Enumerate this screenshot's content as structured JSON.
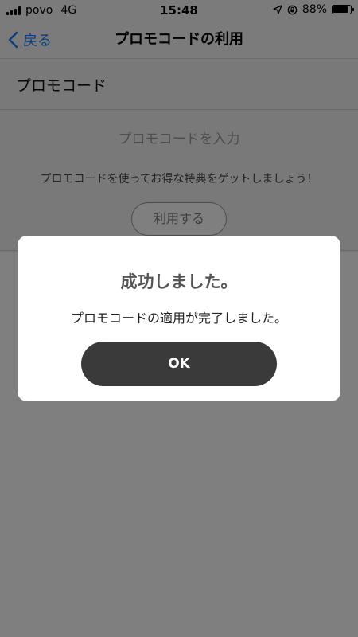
{
  "status_bar": {
    "carrier": "povo",
    "network": "4G",
    "time": "15:48",
    "battery": "88%",
    "battery_level": 0.88
  },
  "nav": {
    "back_label": "戻る",
    "title": "プロモコードの利用"
  },
  "section": {
    "label": "プロモコード"
  },
  "promo": {
    "input_placeholder": "プロモコードを入力",
    "description": "プロモコードを使ってお得な特典をゲットしましょう！",
    "use_button_label": "利用する"
  },
  "dialog": {
    "title": "成功しました。",
    "message": "プロモコードの適用が完了しました。",
    "ok_label": "OK"
  },
  "colors": {
    "accent": "#1a7ef0",
    "ok_button": "#3a3a3a"
  }
}
